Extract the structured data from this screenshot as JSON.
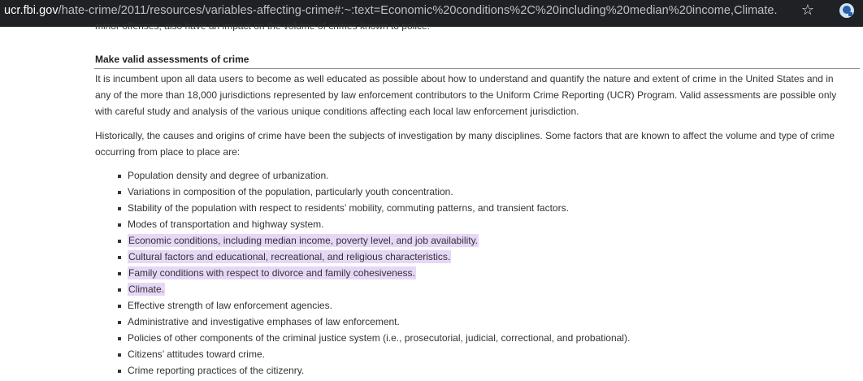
{
  "browser": {
    "url_domain": "ucr.fbi.gov",
    "url_path": "/hate-crime/2011/resources/variables-affecting-crime#:~:text=Economic%20conditions%2C%20including%20median%20income,Climate."
  },
  "page": {
    "cut_text": "minor offenses, also have an impact on the volume of crimes known to police.",
    "heading": "Make valid assessments of crime",
    "paragraph1": "It is incumbent upon all data users to become as well educated as possible about how to understand and quantify the nature and extent of crime in the United States and in any of the more than 18,000 jurisdictions represented by law enforcement contributors to the Uniform Crime Reporting (UCR) Program. Valid assessments are possible only with careful study and analysis of the various unique conditions affecting each local law enforcement jurisdiction.",
    "paragraph2": "Historically, the causes and origins of crime have been the subjects of investigation by many disciplines. Some factors that are known to affect the volume and type of crime occurring from place to place are:",
    "factors": [
      "Population density and degree of urbanization.",
      "Variations in composition of the population, particularly youth concentration.",
      "Stability of the population with respect to residents’ mobility, commuting patterns, and transient factors.",
      "Modes of transportation and highway system.",
      "Economic conditions, including median income, poverty level, and job availability.",
      "Cultural factors and educational, recreational, and religious characteristics.",
      "Family conditions with respect to divorce and family cohesiveness.",
      "Climate.",
      "Effective strength of law enforcement agencies.",
      "Administrative and investigative emphases of law enforcement.",
      "Policies of other components of the criminal justice system (i.e., prosecutorial, judicial, correctional, and probational).",
      "Citizens’ attitudes toward crime.",
      "Crime reporting practices of the citizenry."
    ]
  },
  "colors": {
    "highlight": "#e7d7f7",
    "toolbar": "#202124"
  },
  "icons": [
    "star-icon",
    "extension-icon"
  ]
}
